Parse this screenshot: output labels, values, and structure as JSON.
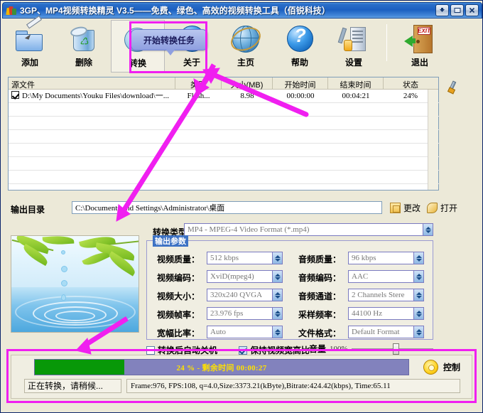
{
  "window": {
    "title": "3GP、MP4视频转换精灵 V3.5——免费、绿色、高效的视频转换工具（佰锐科技）",
    "minimize_label": "▼",
    "maximize_label": "",
    "close_label": "✕"
  },
  "toolbar": {
    "items": [
      {
        "label": "添加",
        "icon": "add-folder-icon"
      },
      {
        "label": "删除",
        "icon": "recycle-bin-icon"
      },
      {
        "label": "转换",
        "icon": "convert-disc-icon"
      },
      {
        "label": "关于",
        "icon": "info-icon"
      },
      {
        "label": "主页",
        "icon": "globe-icon"
      },
      {
        "label": "帮助",
        "icon": "question-icon"
      },
      {
        "label": "设置",
        "icon": "settings-tower-icon"
      },
      {
        "label": "退出",
        "icon": "exit-door-icon"
      }
    ],
    "tooltip": "开始转换任务"
  },
  "filelist": {
    "headers": [
      "源文件",
      "类型",
      "大小(MB)",
      "开始时间",
      "结束时间",
      "状态"
    ],
    "rows": [
      {
        "checked": true,
        "source": "D:\\My Documents\\Youku Files\\download\\一...",
        "type": "Flash...",
        "size": "8.98",
        "start": "00:00:00",
        "end": "00:04:21",
        "status": "24%"
      }
    ]
  },
  "output": {
    "dir_label": "输出目录",
    "dir_value": "C:\\Documents and Settings\\Administrator\\桌面",
    "change_label": "更改",
    "open_label": "打开"
  },
  "convert": {
    "type_label": "转换类型",
    "type_value": "MP4 - MPEG-4 Video Format (*.mp4)"
  },
  "params": {
    "legend": "输出参数",
    "left": [
      {
        "label": "视频质量：",
        "value": "512 kbps"
      },
      {
        "label": "视频编码：",
        "value": "XviD(mpeg4)"
      },
      {
        "label": "视频大小：",
        "value": "320x240 QVGA"
      },
      {
        "label": "视频帧率：",
        "value": "23.976 fps"
      },
      {
        "label": "宽幅比率：",
        "value": "Auto"
      }
    ],
    "right": [
      {
        "label": "音频质量：",
        "value": "96  kbps"
      },
      {
        "label": "音频编码：",
        "value": "AAC"
      },
      {
        "label": "音频通道：",
        "value": "2 Channels Stere"
      },
      {
        "label": "采样频率：",
        "value": "44100 Hz"
      },
      {
        "label": "文件格式：",
        "value": "Default Format"
      }
    ]
  },
  "options": {
    "shutdown_label": "转换后自动关机",
    "shutdown_checked": false,
    "aspect_label": "保持视频宽高比",
    "aspect_checked": true,
    "volume_label": "音量",
    "volume_value": "100%"
  },
  "progress": {
    "percent": 24,
    "text": "24 % - 剩余时间 00:00:27",
    "control_label": "控制",
    "status": "正在转换，请稍候...",
    "detail": "Frame:976, FPS:108, q=4.0,Size:3373.21(kByte),Bitrate:424.42(kbps), Time:65.11"
  },
  "colors": {
    "titlebar_blue": "#1c5fc0",
    "progress_fill_green": "#089808",
    "progress_track_purple": "#8282bd",
    "progress_text_yellow": "#ffe100",
    "annotation_magenta": "#f01ff0"
  },
  "exit_sign_text": "EXIT"
}
